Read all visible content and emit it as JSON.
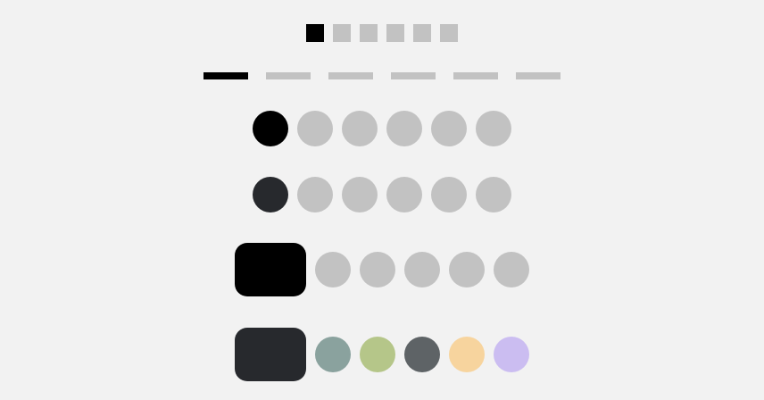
{
  "colors": {
    "inactive": "#c2c2c2",
    "active_black": "#000000",
    "active_dark": "#27292d",
    "background": "#f2f2f2"
  },
  "indicators": {
    "squares": {
      "count": 6,
      "active_index": 0,
      "active_color": "#000000"
    },
    "bars": {
      "count": 6,
      "active_index": 0,
      "active_color": "#000000"
    },
    "dots_black": {
      "count": 6,
      "active_index": 0,
      "active_color": "#000000"
    },
    "dots_dark": {
      "count": 6,
      "active_index": 0,
      "active_color": "#27292d"
    },
    "pill_black": {
      "count": 5,
      "active_color": "#000000",
      "dot_colors": [
        "#c2c2c2",
        "#c2c2c2",
        "#c2c2c2",
        "#c2c2c2",
        "#c2c2c2"
      ]
    },
    "pill_colors": {
      "count": 5,
      "active_color": "#27292d",
      "dot_colors": [
        "#8aa29e",
        "#b5c689",
        "#5e6366",
        "#f7d49e",
        "#cbbdf1"
      ]
    }
  }
}
